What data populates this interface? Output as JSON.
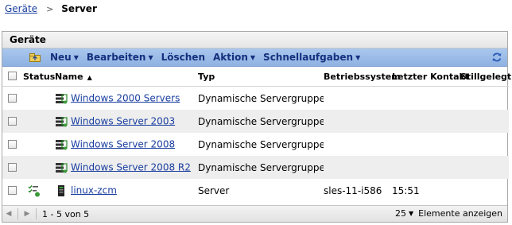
{
  "breadcrumb": {
    "parent": "Geräte",
    "current": "Server"
  },
  "panel": {
    "title": "Geräte"
  },
  "toolbar": {
    "new": "Neu",
    "edit": "Bearbeiten",
    "delete": "Löschen",
    "action": "Aktion",
    "quick_tasks": "Schnellaufgaben"
  },
  "columns": {
    "status": "Status",
    "name": "Name",
    "type": "Typ",
    "os": "Betriebssystem",
    "last_contact": "Letzter Kontakt",
    "retired": "Stillgelegt"
  },
  "rows": [
    {
      "name": "Windows 2000 Servers",
      "type": "Dynamische Servergruppe",
      "os": "",
      "last_contact": ""
    },
    {
      "name": "Windows Server 2003",
      "type": "Dynamische Servergruppe",
      "os": "",
      "last_contact": ""
    },
    {
      "name": "Windows Server 2008",
      "type": "Dynamische Servergruppe",
      "os": "",
      "last_contact": ""
    },
    {
      "name": "Windows Server 2008 R2",
      "type": "Dynamische Servergruppe",
      "os": "",
      "last_contact": ""
    },
    {
      "name": "linux-zcm",
      "type": "Server",
      "os": "sles-11-i586",
      "last_contact": "15:51"
    }
  ],
  "footer": {
    "range": "1 - 5 von 5",
    "page_size": "25",
    "show_label": "Elemente anzeigen"
  },
  "colors": {
    "link": "#1a3fa0",
    "toolbar_text": "#15307d",
    "toolbar_bg": "#9dbde8",
    "alt_row": "#eeeeee"
  }
}
